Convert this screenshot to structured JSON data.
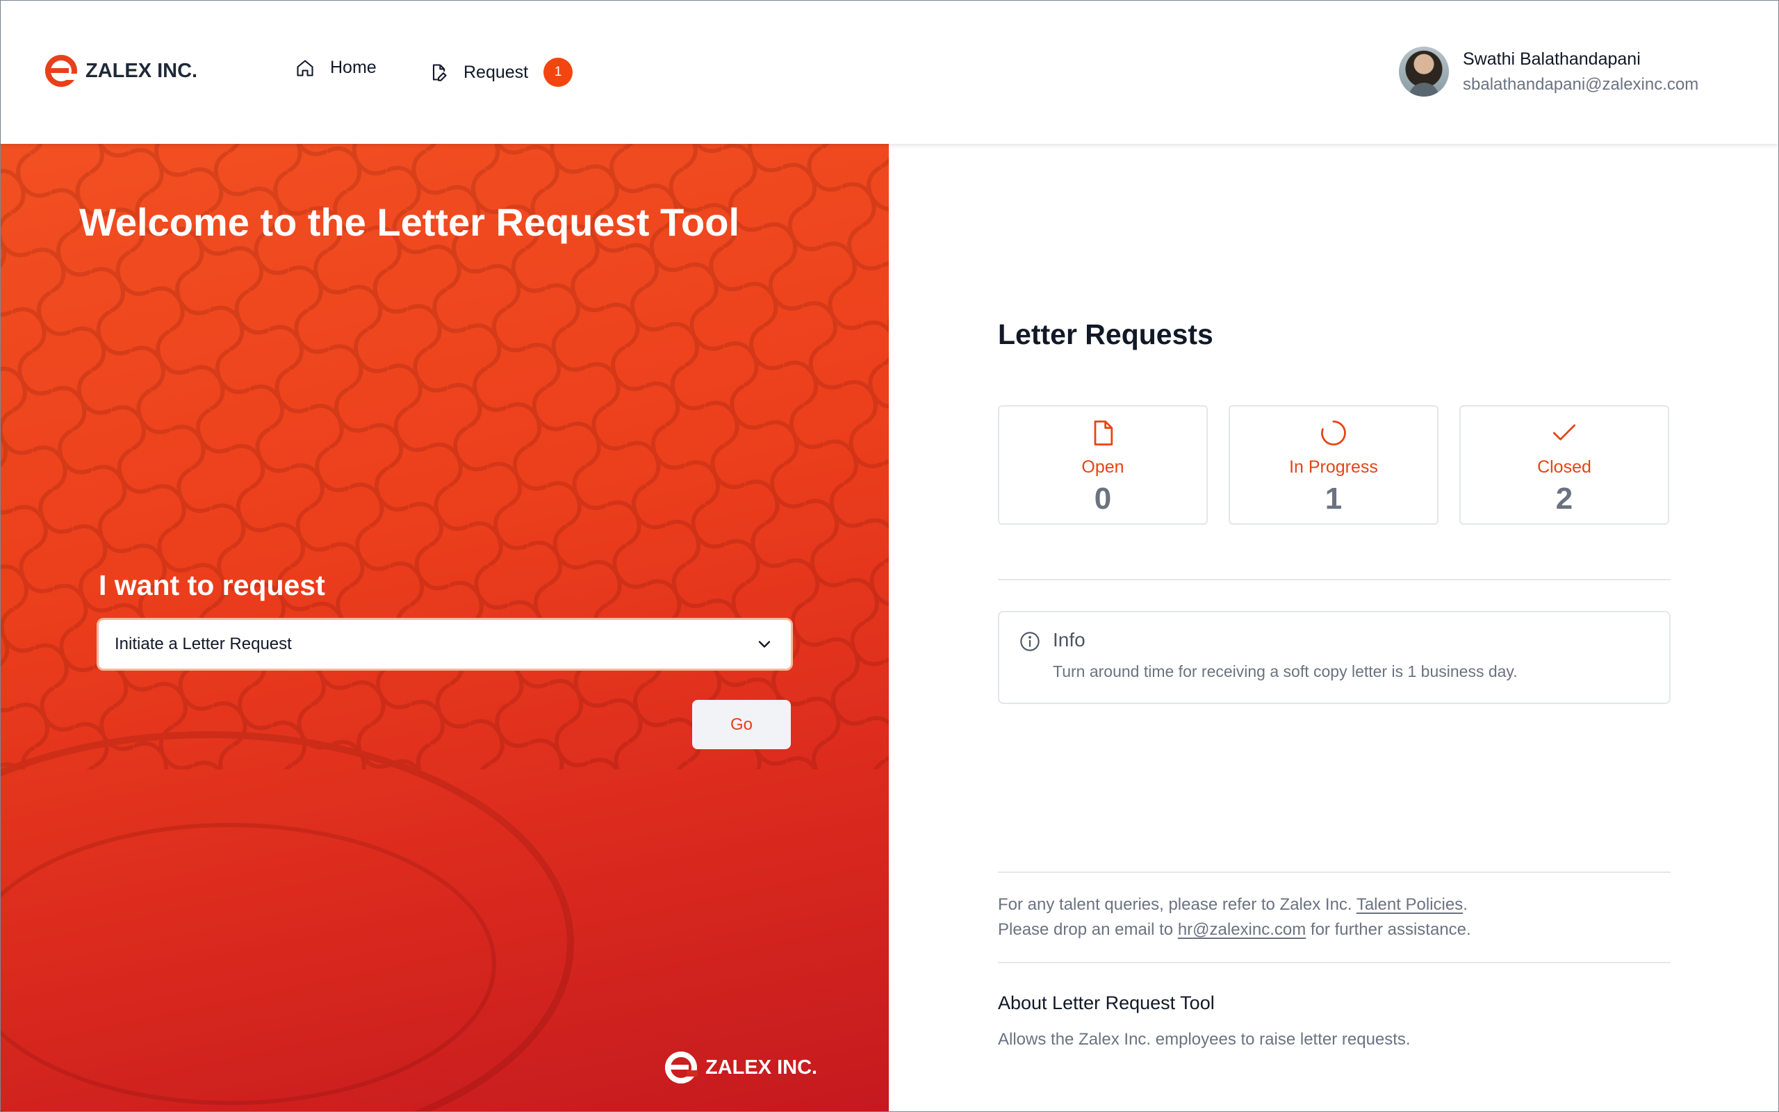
{
  "header": {
    "brand": "ZALEX INC.",
    "nav": {
      "home_label": "Home",
      "request_label": "Request",
      "request_badge": "1"
    },
    "user": {
      "name": "Swathi Balathandapani",
      "email": "sbalathandapani@zalexinc.com"
    }
  },
  "hero": {
    "title": "Welcome to the Letter Request Tool",
    "request_label": "I want to request",
    "select_value": "Initiate a Letter Request",
    "go_label": "Go",
    "footer_brand": "ZALEX INC."
  },
  "requests": {
    "title": "Letter Requests",
    "stats": [
      {
        "label": "Open",
        "value": "0",
        "icon": "file-icon"
      },
      {
        "label": "In Progress",
        "value": "1",
        "icon": "spinner-icon"
      },
      {
        "label": "Closed",
        "value": "2",
        "icon": "check-icon"
      }
    ]
  },
  "info": {
    "title": "Info",
    "text": "Turn around time for receiving a soft copy letter is 1 business day."
  },
  "footer": {
    "line1_prefix": "For any talent queries, please refer to Zalex Inc. ",
    "line1_link": "Talent Policies",
    "line1_suffix": ".",
    "line2_prefix": "Please drop an email to ",
    "line2_link": "hr@zalexinc.com",
    "line2_suffix": " for further assistance.",
    "about_title": "About Letter Request Tool",
    "about_text": "Allows the Zalex Inc. employees to raise letter requests."
  },
  "colors": {
    "accent": "#f2450f",
    "hero_top": "#f25022",
    "hero_bottom": "#c4191f"
  }
}
